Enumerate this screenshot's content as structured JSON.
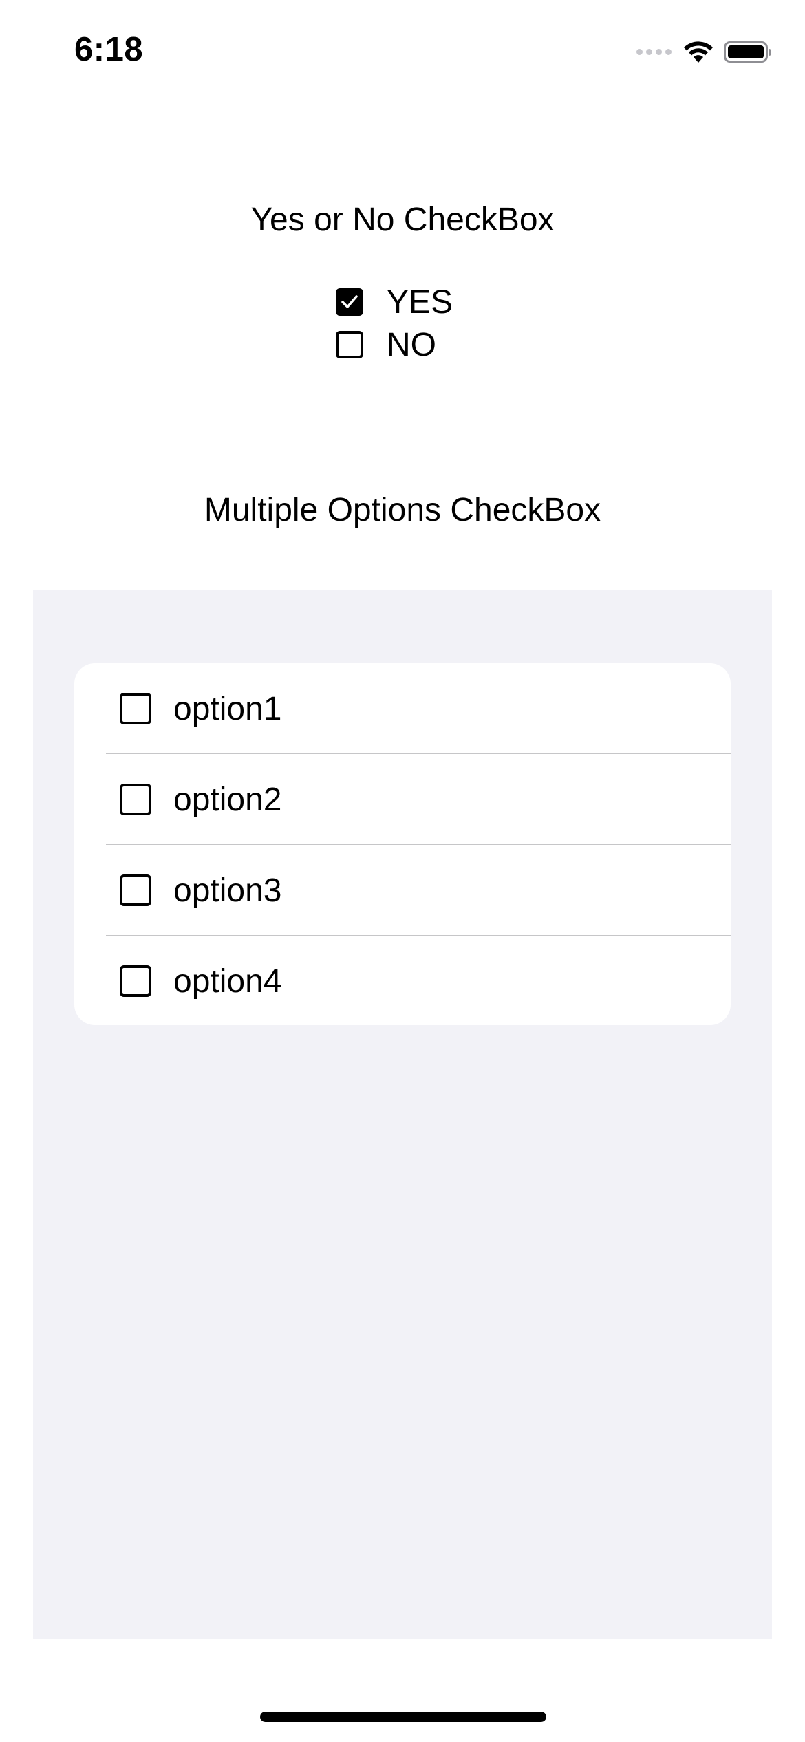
{
  "status_bar": {
    "time": "6:18",
    "icons": [
      "cellular-signal-icon",
      "wifi-icon",
      "battery-icon"
    ]
  },
  "yes_no": {
    "title": "Yes or No CheckBox",
    "options": [
      {
        "label": "YES",
        "checked": true
      },
      {
        "label": "NO",
        "checked": false
      }
    ]
  },
  "multiple": {
    "title": "Multiple Options CheckBox",
    "options": [
      {
        "label": "option1",
        "checked": false
      },
      {
        "label": "option2",
        "checked": false
      },
      {
        "label": "option3",
        "checked": false
      },
      {
        "label": "option4",
        "checked": false
      }
    ]
  },
  "colors": {
    "text": "#000000",
    "background": "#ffffff",
    "grouped_background": "#f2f2f7",
    "separator": "#c6c6c8"
  }
}
